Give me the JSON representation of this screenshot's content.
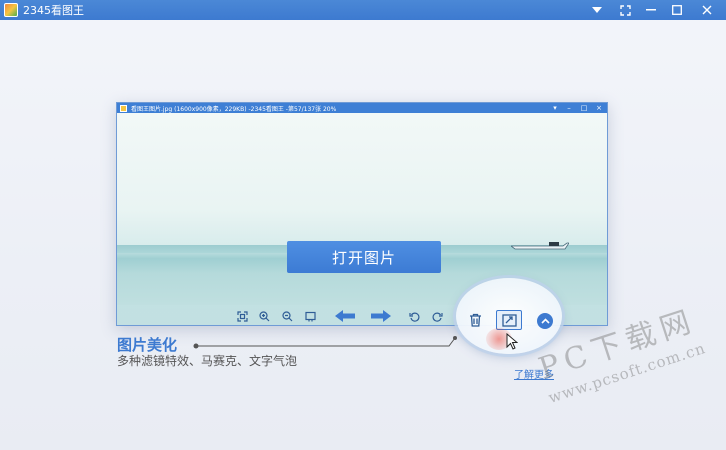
{
  "window": {
    "title": "2345看图王",
    "controls": [
      "menu",
      "fullscreen",
      "minimize",
      "maximize",
      "close"
    ]
  },
  "viewer": {
    "title": "看图王图片.jpg (1600x900像素，229KB) -2345看图王 -第57/137张 20%",
    "controls": [
      "menu",
      "minimize",
      "maximize",
      "close"
    ],
    "open_button_label": "打开图片",
    "toolbar": [
      "fit-icon",
      "zoom-in-icon",
      "zoom-out-icon",
      "original-size-icon",
      "prev-arrow-icon",
      "next-arrow-icon",
      "rotate-left-icon",
      "rotate-right-icon",
      "delete-icon",
      "beautify-icon",
      "expand-up-icon"
    ]
  },
  "feature": {
    "title": "图片美化",
    "description": "多种滤镜特效、马赛克、文字气泡",
    "learn_more": "了解更多"
  },
  "watermark": {
    "line1": "PC下载网",
    "line2": "www.pcsoft.com.cn"
  },
  "colors": {
    "accent": "#3d7ad0",
    "titlebar": "#4b88d6",
    "highlight": "#e8473b"
  }
}
